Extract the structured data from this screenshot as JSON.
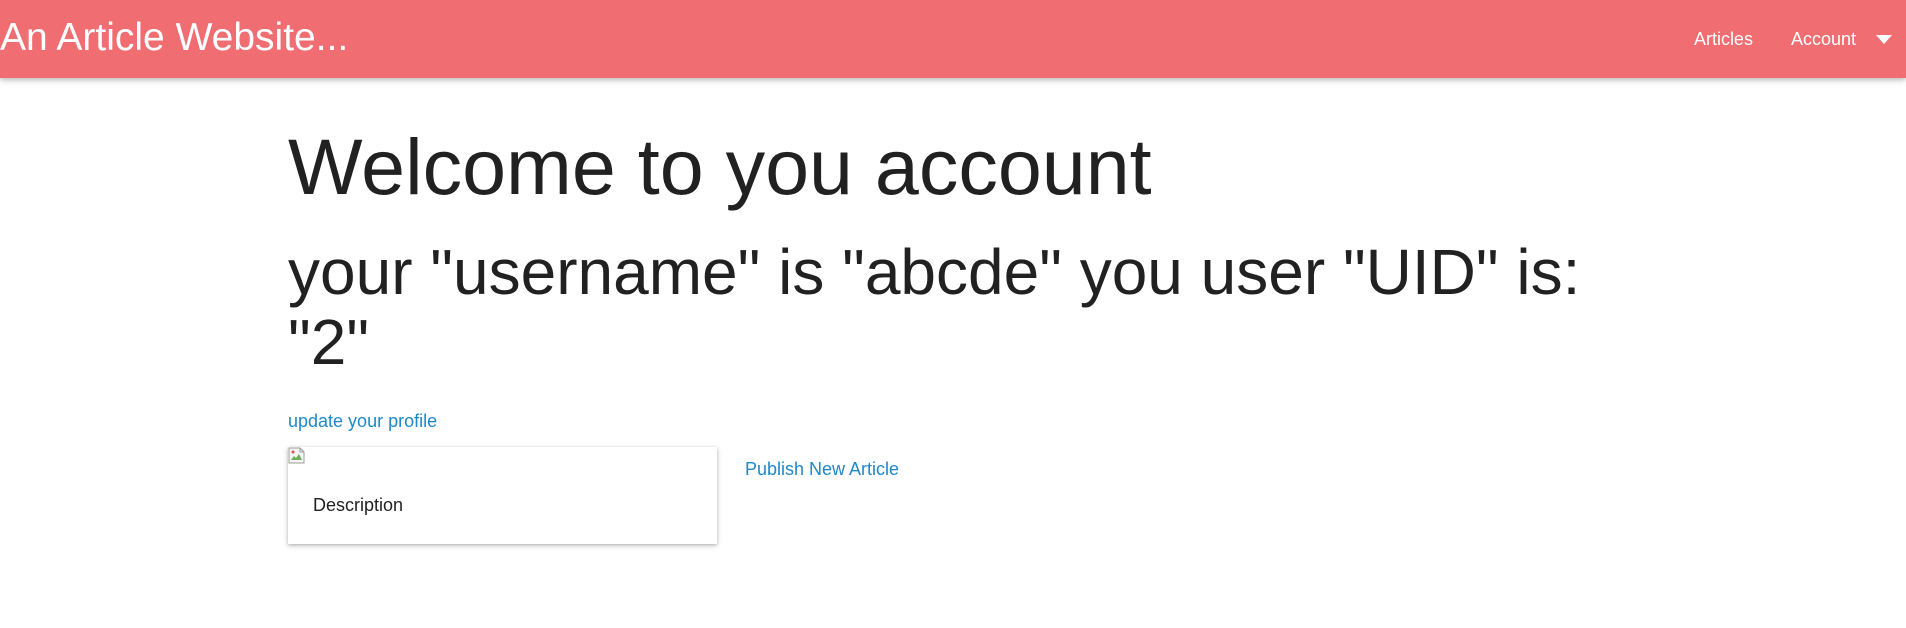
{
  "navbar": {
    "brand": "An Article Website...",
    "background_color": "#f06d72",
    "links": [
      {
        "label": "Articles"
      },
      {
        "label": "Account"
      }
    ],
    "dropdown_icon": "caret-down-icon"
  },
  "main": {
    "title": "Welcome to you account",
    "subtitle": "your \"username\" is \"abcde\" you user \"UID\" is: \"2\"",
    "update_profile_link": "update your profile",
    "card": {
      "image_icon": "broken-image-icon",
      "description": "Description"
    },
    "publish_link": "Publish New Article",
    "link_color": "#1e88c8"
  }
}
